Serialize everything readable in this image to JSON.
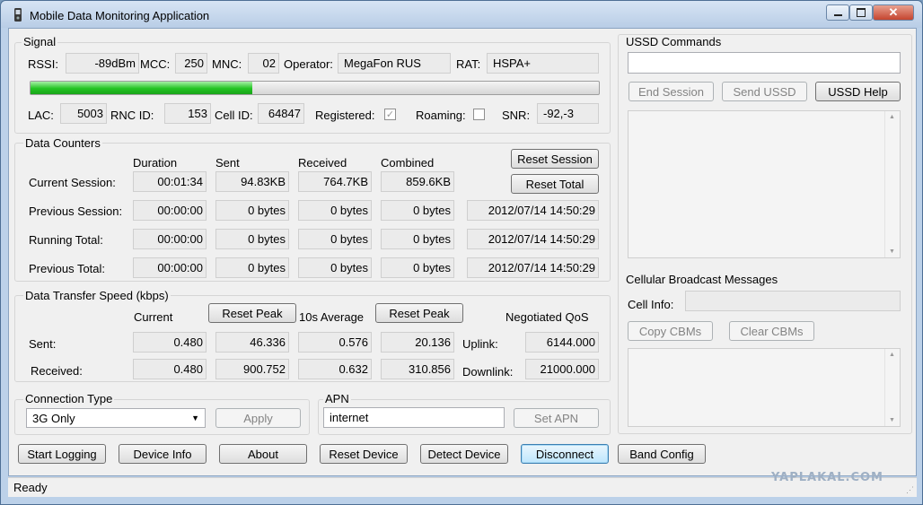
{
  "window": {
    "title": "Mobile Data Monitoring Application",
    "status": "Ready",
    "watermark": "YAPLAKAL.COM"
  },
  "signal": {
    "group": "Signal",
    "rssi_label": "RSSI:",
    "rssi": "-89dBm",
    "mcc_label": "MCC:",
    "mcc": "250",
    "mnc_label": "MNC:",
    "mnc": "02",
    "operator_label": "Operator:",
    "operator": "MegaFon RUS",
    "rat_label": "RAT:",
    "rat": "HSPA+",
    "strength_fraction": 0.39,
    "lac_label": "LAC:",
    "lac": "5003",
    "rnc_label": "RNC ID:",
    "rnc": "153",
    "cell_label": "Cell ID:",
    "cell": "64847",
    "registered_label": "Registered:",
    "registered": true,
    "roaming_label": "Roaming:",
    "roaming": false,
    "snr_label": "SNR:",
    "snr": "-92,-3"
  },
  "counters": {
    "group": "Data Counters",
    "headers": [
      "Duration",
      "Sent",
      "Received",
      "Combined"
    ],
    "reset_session": "Reset Session",
    "reset_total": "Reset Total",
    "rows": [
      {
        "label": "Current Session:",
        "values": [
          "00:01:34",
          "94.83KB",
          "764.7KB",
          "859.6KB"
        ],
        "date": ""
      },
      {
        "label": "Previous Session:",
        "values": [
          "00:00:00",
          "0 bytes",
          "0 bytes",
          "0 bytes"
        ],
        "date": "2012/07/14 14:50:29"
      },
      {
        "label": "Running Total:",
        "values": [
          "00:00:00",
          "0 bytes",
          "0 bytes",
          "0 bytes"
        ],
        "date": "2012/07/14 14:50:29"
      },
      {
        "label": "Previous Total:",
        "values": [
          "00:00:00",
          "0 bytes",
          "0 bytes",
          "0 bytes"
        ],
        "date": "2012/07/14 14:50:29"
      }
    ]
  },
  "speed": {
    "group": "Data Transfer Speed (kbps)",
    "current_label": "Current",
    "reset_peak": "Reset Peak",
    "avg_label": "10s Average",
    "qos_label": "Negotiated QoS",
    "sent_label": "Sent:",
    "received_label": "Received:",
    "uplink_label": "Uplink:",
    "downlink_label": "Downlink:",
    "sent": [
      "0.480",
      "46.336",
      "0.576",
      "20.136"
    ],
    "received": [
      "0.480",
      "900.752",
      "0.632",
      "310.856"
    ],
    "uplink": "6144.000",
    "downlink": "21000.000"
  },
  "connection": {
    "group": "Connection Type",
    "selected": "3G Only",
    "apply": "Apply"
  },
  "apn": {
    "group": "APN",
    "value": "internet",
    "set": "Set APN"
  },
  "buttons": {
    "start_logging": "Start Logging",
    "device_info": "Device Info",
    "about": "About",
    "reset_device": "Reset Device",
    "detect_device": "Detect Device",
    "disconnect": "Disconnect",
    "band_config": "Band Config"
  },
  "ussd": {
    "group": "USSD Commands",
    "end_session": "End Session",
    "send": "Send USSD",
    "help": "USSD Help"
  },
  "cbm": {
    "group": "Cellular Broadcast Messages",
    "cell_info_label": "Cell Info:",
    "copy": "Copy CBMs",
    "clear": "Clear CBMs"
  },
  "colors": {
    "accent_green": "#22c422",
    "window_frame": "#bcd1e9",
    "face": "#f0f0f0"
  }
}
